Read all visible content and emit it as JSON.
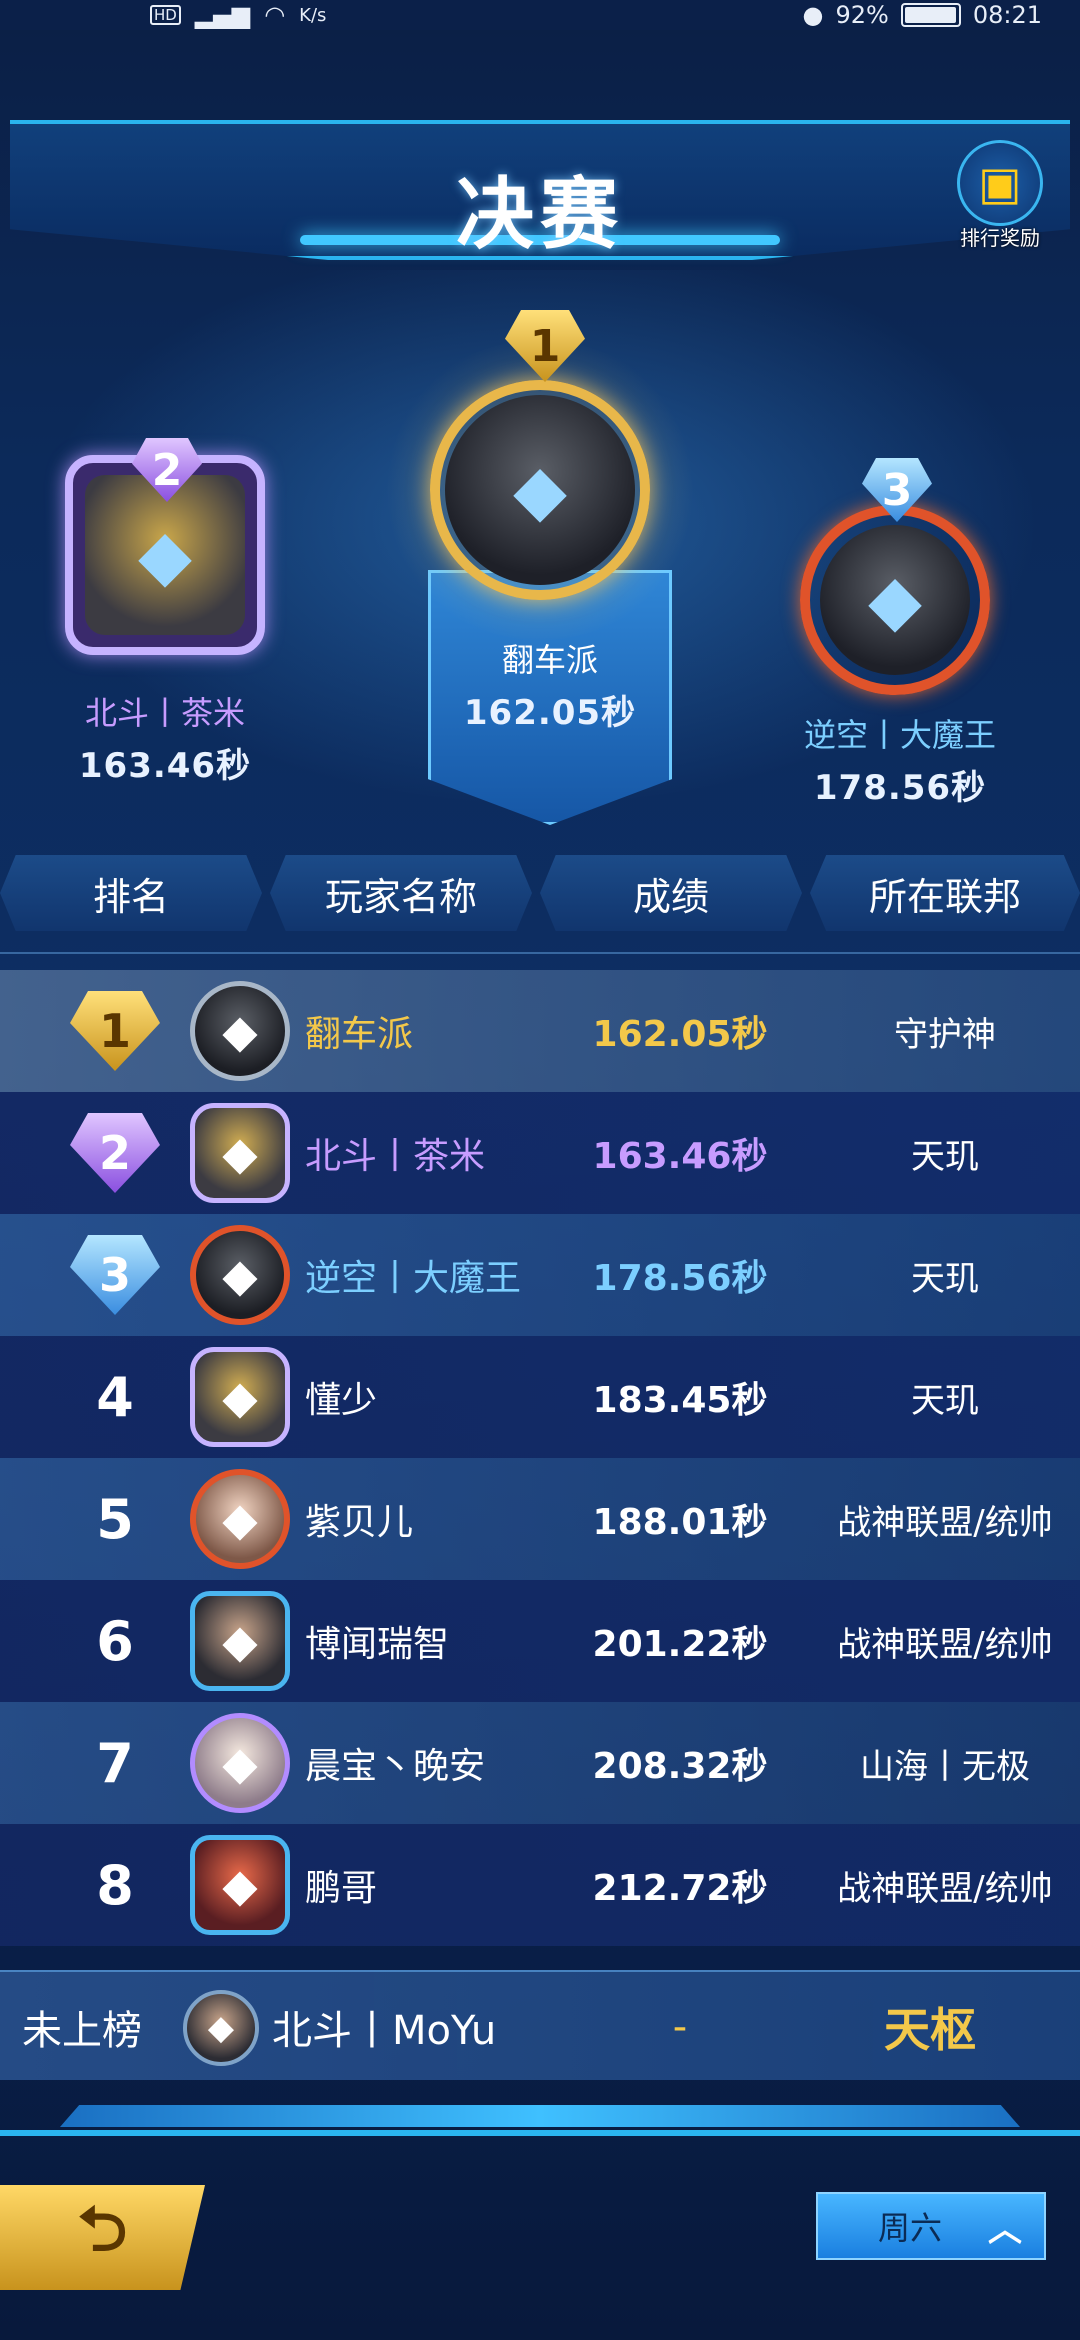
{
  "status_bar": {
    "hd": "HD",
    "speed": "K/s",
    "battery": "92%",
    "battery_level": 0.92,
    "time": "08:21"
  },
  "header": {
    "title": "决赛",
    "reward_label": "排行奖励",
    "reward_icon": "gift-icon"
  },
  "podium": {
    "first": {
      "rank": "1",
      "name": "翻车派",
      "time": "162.05秒",
      "name_color": "#ffffff"
    },
    "second": {
      "rank": "2",
      "name": "北斗丨茶米",
      "time": "163.46秒",
      "name_color": "#c79cff"
    },
    "third": {
      "rank": "3",
      "name": "逆空丨大魔王",
      "time": "178.56秒",
      "name_color": "#7ccfff"
    }
  },
  "columns": {
    "rank": "排名",
    "player": "玩家名称",
    "score": "成绩",
    "federation": "所在联邦"
  },
  "rows": [
    {
      "rank": "1",
      "name": "翻车派",
      "score": "162.05秒",
      "federation": "守护神",
      "color": "#f3c84a"
    },
    {
      "rank": "2",
      "name": "北斗丨茶米",
      "score": "163.46秒",
      "federation": "天玑",
      "color": "#c79cff"
    },
    {
      "rank": "3",
      "name": "逆空丨大魔王",
      "score": "178.56秒",
      "federation": "天玑",
      "color": "#7ccfff"
    },
    {
      "rank": "4",
      "name": "懂少",
      "score": "183.45秒",
      "federation": "天玑",
      "color": "#ffffff"
    },
    {
      "rank": "5",
      "name": "紫贝儿",
      "score": "188.01秒",
      "federation": "战神联盟/统帅",
      "color": "#ffffff"
    },
    {
      "rank": "6",
      "name": "博闻瑞智",
      "score": "201.22秒",
      "federation": "战神联盟/统帅",
      "color": "#ffffff"
    },
    {
      "rank": "7",
      "name": "晨宝丶晚安",
      "score": "208.32秒",
      "federation": "山海丨无极",
      "color": "#ffffff"
    },
    {
      "rank": "8",
      "name": "鹏哥",
      "score": "212.72秒",
      "federation": "战神联盟/统帅",
      "color": "#ffffff"
    }
  ],
  "self": {
    "label": "未上榜",
    "name": "北斗丨MoYu",
    "score": "-",
    "federation": "天枢"
  },
  "footer": {
    "day_label": "周六"
  }
}
